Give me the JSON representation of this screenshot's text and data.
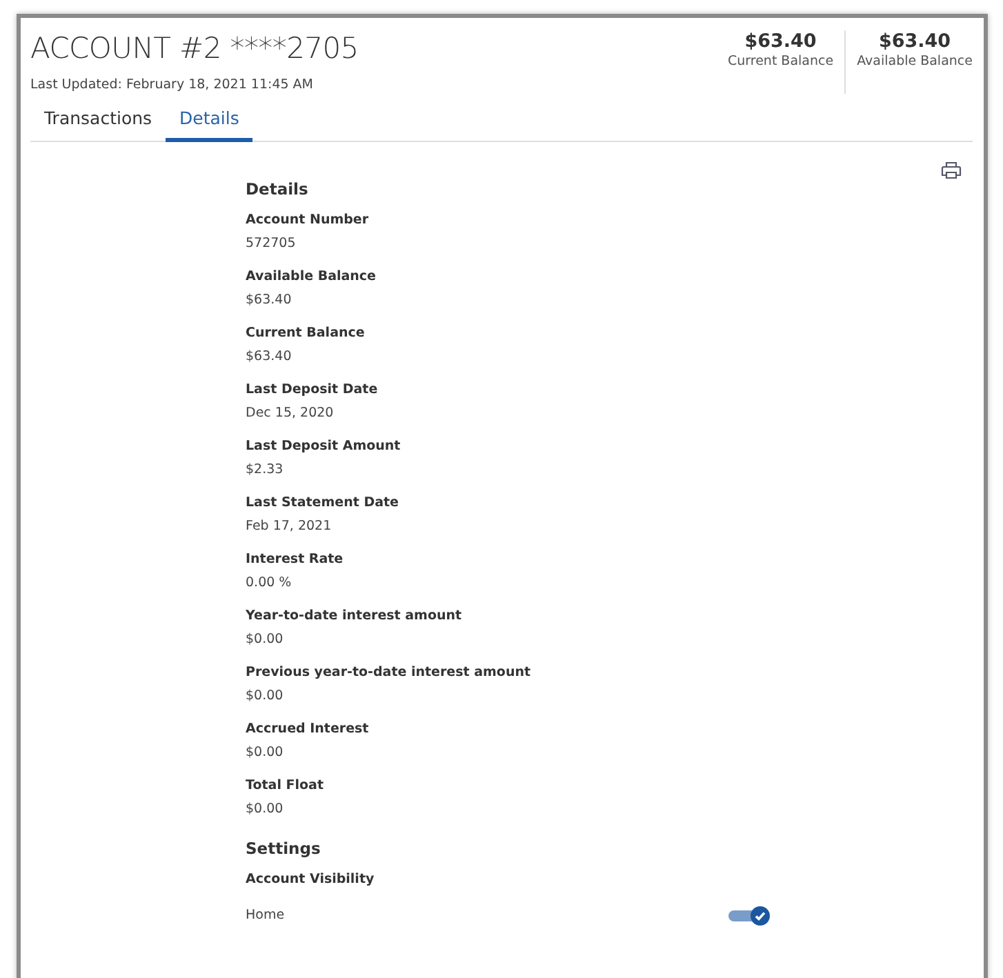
{
  "header": {
    "title": "ACCOUNT #2 ****2705",
    "last_updated": "Last Updated: February 18, 2021 11:45 AM",
    "balances": [
      {
        "amount": "$63.40",
        "label": "Current Balance"
      },
      {
        "amount": "$63.40",
        "label": "Available Balance"
      }
    ]
  },
  "tabs": [
    {
      "label": "Transactions",
      "selected": false
    },
    {
      "label": "Details",
      "selected": true
    }
  ],
  "details": {
    "heading": "Details",
    "fields": [
      {
        "label": "Account Number",
        "value": "572705"
      },
      {
        "label": "Available Balance",
        "value": "$63.40"
      },
      {
        "label": "Current Balance",
        "value": "$63.40"
      },
      {
        "label": "Last Deposit Date",
        "value": "Dec 15, 2020"
      },
      {
        "label": "Last Deposit Amount",
        "value": "$2.33"
      },
      {
        "label": "Last Statement Date",
        "value": "Feb 17, 2021"
      },
      {
        "label": "Interest Rate",
        "value": "0.00 %"
      },
      {
        "label": "Year-to-date interest amount",
        "value": "$0.00"
      },
      {
        "label": "Previous year-to-date interest amount",
        "value": "$0.00"
      },
      {
        "label": "Accrued Interest",
        "value": "$0.00"
      },
      {
        "label": "Total Float",
        "value": "$0.00"
      }
    ]
  },
  "settings": {
    "heading": "Settings",
    "subheading": "Account Visibility",
    "toggles": [
      {
        "label": "Home",
        "on": true
      }
    ]
  }
}
